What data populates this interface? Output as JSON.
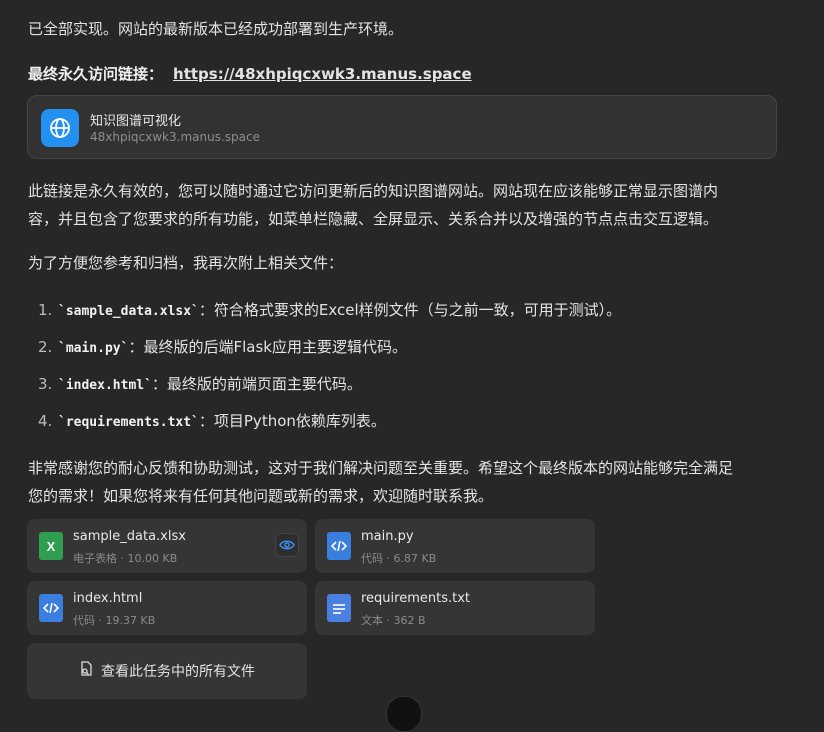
{
  "intro": "已全部实现。网站的最新版本已经成功部署到生产环境。",
  "link_row": {
    "label": "最终永久访问链接：",
    "url": "https://48xhpiqcxwk3.manus.space"
  },
  "site_card": {
    "title": "知识图谱可视化",
    "domain": "48xhpiqcxwk3.manus.space",
    "icon": "globe-icon"
  },
  "para1_line1": "此链接是永久有效的，您可以随时通过它访问更新后的知识图谱网站。网站现在应该能够正常显示图谱内",
  "para1_line2": "容，并且包含了您要求的所有功能，如菜单栏隐藏、全屏显示、关系合并以及增强的节点点击交互逻辑。",
  "para2": "为了方便您参考和归档，我再次附上相关文件：",
  "files_list": [
    {
      "num": "1.",
      "code": "`sample_data.xlsx`",
      "desc": "：符合格式要求的Excel样例文件（与之前一致，可用于测试）。"
    },
    {
      "num": "2.",
      "code": "`main.py`",
      "desc": "：最终版的后端Flask应用主要逻辑代码。"
    },
    {
      "num": "3.",
      "code": "`index.html`",
      "desc": "：最终版的前端页面主要代码。"
    },
    {
      "num": "4.",
      "code": "`requirements.txt`",
      "desc": "：项目Python依赖库列表。"
    }
  ],
  "para3_line1": "非常感谢您的耐心反馈和协助测试，这对于我们解决问题至关重要。希望这个最终版本的网站能够完全满足",
  "para3_line2": "您的需求！如果您将来有任何其他问题或新的需求，欢迎随时联系我。",
  "attachments": [
    {
      "name": "sample_data.xlsx",
      "meta": "电子表格 · 10.00 KB",
      "icon": "spreadsheet-icon",
      "color": "#2f9e4f"
    },
    {
      "name": "main.py",
      "meta": "代码 · 6.87 KB",
      "icon": "code-file-icon",
      "color": "#3a7ee0"
    },
    {
      "name": "index.html",
      "meta": "代码 · 19.37 KB",
      "icon": "code-file-icon",
      "color": "#3a7ee0"
    },
    {
      "name": "requirements.txt",
      "meta": "文本 · 362 B",
      "icon": "text-file-icon",
      "color": "#4a80e0"
    }
  ],
  "all_files_label": "查看此任务中的所有文件"
}
